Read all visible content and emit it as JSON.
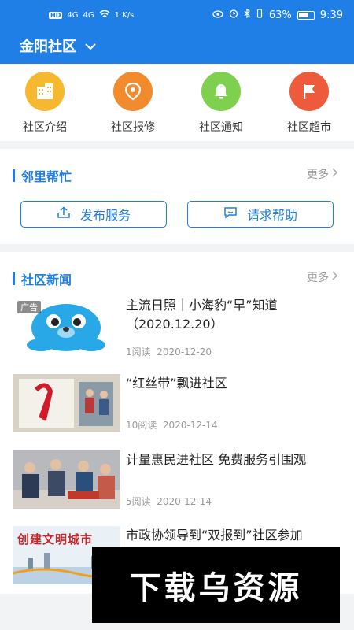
{
  "status": {
    "network": "4G",
    "network2": "4G",
    "speed": "1 K/s",
    "battery": "63%",
    "time": "9:39"
  },
  "header": {
    "community": "金阳社区"
  },
  "quick_actions": [
    {
      "label": "社区介绍",
      "icon": "building-icon",
      "color": "#f5b82e"
    },
    {
      "label": "社区报修",
      "icon": "location-icon",
      "color": "#f28a2e"
    },
    {
      "label": "社区通知",
      "icon": "bell-icon",
      "color": "#7ed04e"
    },
    {
      "label": "社区超市",
      "icon": "flag-icon",
      "color": "#ee5a3c"
    }
  ],
  "help": {
    "title": "邻里帮忙",
    "more": "更多",
    "publish": "发布服务",
    "request": "请求帮助"
  },
  "news": {
    "title": "社区新闻",
    "more": "更多",
    "items": [
      {
        "title": "主流日照｜小海豹“早”知道（2020.12.20）",
        "reads": "1阅读",
        "date": "2020-12-20",
        "tag": "广告"
      },
      {
        "title": "“红丝带”飘进社区",
        "reads": "10阅读",
        "date": "2020-12-14"
      },
      {
        "title": "计量惠民进社区 免费服务引围观",
        "reads": "5阅读",
        "date": "2020-12-14"
      },
      {
        "title": "市政协领导到“双报到”社区参加",
        "reads": "",
        "date": ""
      }
    ]
  },
  "watermark": "下载乌资源",
  "thumb_banner": "创建文明城市"
}
